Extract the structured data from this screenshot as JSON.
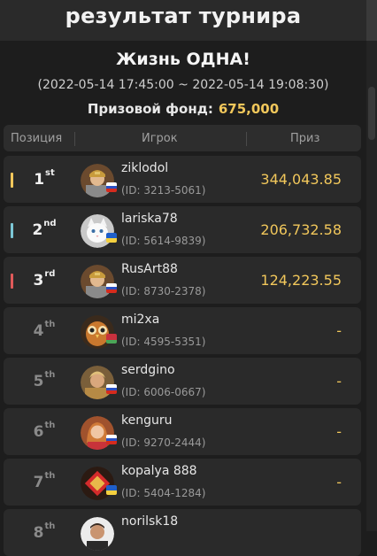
{
  "header": {
    "title": "результат турнира"
  },
  "tournament": {
    "name": "Жизнь ОДНА!",
    "dates": "(2022-05-14 17:45:00 ~ 2022-05-14 19:08:30)",
    "prize_label": "Призовой фонд:",
    "prize_amount": "675,000"
  },
  "table": {
    "headers": {
      "position": "Позиция",
      "player": "Игрок",
      "prize": "Приз"
    },
    "rows": [
      {
        "rank": "1",
        "suffix": "st",
        "name": "ziklodol",
        "id": "(ID: 3213-5061)",
        "prize": "344,043.85",
        "bar_color": "#f1c75b",
        "flag": "ru",
        "avatar": "knight"
      },
      {
        "rank": "2",
        "suffix": "nd",
        "name": "lariska78",
        "id": "(ID: 5614-9839)",
        "prize": "206,732.58",
        "bar_color": "#7cc7d6",
        "flag": "ua",
        "avatar": "cat"
      },
      {
        "rank": "3",
        "suffix": "rd",
        "name": "RusArt88",
        "id": "(ID: 8730-2378)",
        "prize": "124,223.55",
        "bar_color": "#e05a5a",
        "flag": "ru",
        "avatar": "knight"
      },
      {
        "rank": "4",
        "suffix": "th",
        "name": "mi2xa",
        "id": "(ID: 4595-5351)",
        "prize": "-",
        "bar_color": "",
        "flag": "by",
        "avatar": "owl"
      },
      {
        "rank": "5",
        "suffix": "th",
        "name": "serdgino",
        "id": "(ID: 6006-0667)",
        "prize": "-",
        "bar_color": "",
        "flag": "ru",
        "avatar": "warrior"
      },
      {
        "rank": "6",
        "suffix": "th",
        "name": "kenguru",
        "id": "(ID: 9270-2444)",
        "prize": "-",
        "bar_color": "",
        "flag": "ru",
        "avatar": "woman"
      },
      {
        "rank": "7",
        "suffix": "th",
        "name": "kopalya 888",
        "id": "(ID: 5404-1284)",
        "prize": "-",
        "bar_color": "",
        "flag": "ua",
        "avatar": "diamond"
      },
      {
        "rank": "8",
        "suffix": "th",
        "name": "norilsk18",
        "id": "",
        "prize": "",
        "bar_color": "",
        "flag": "",
        "avatar": "man"
      }
    ]
  }
}
